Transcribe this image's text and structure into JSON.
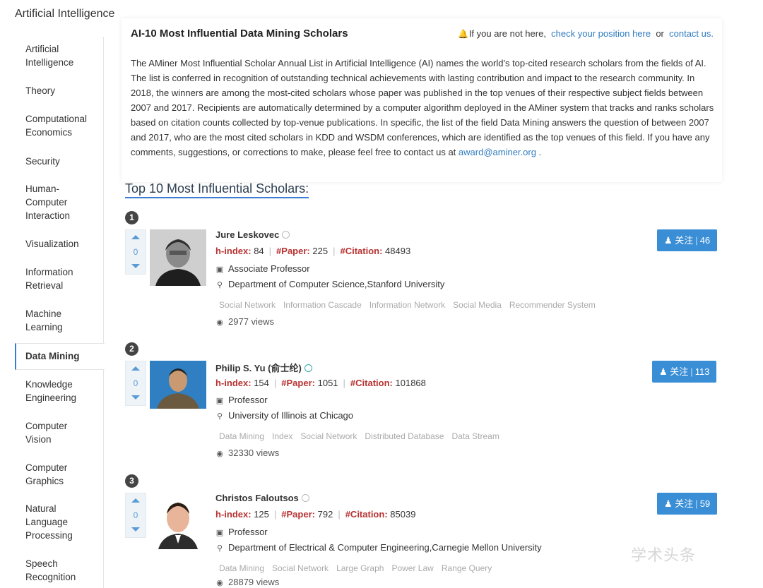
{
  "section_title": "Artificial Intelligence",
  "sidebar": {
    "items": [
      {
        "label": "Artificial Intelligence",
        "lines": [
          "Artificial",
          "Intelligence"
        ]
      },
      {
        "label": "Theory",
        "lines": [
          "Theory"
        ]
      },
      {
        "label": "Computational Economics",
        "lines": [
          "Computational",
          "Economics"
        ]
      },
      {
        "label": "Security",
        "lines": [
          "Security"
        ]
      },
      {
        "label": "Human-Computer Interaction",
        "lines": [
          "Human-",
          "Computer",
          "Interaction"
        ]
      },
      {
        "label": "Visualization",
        "lines": [
          "Visualization"
        ]
      },
      {
        "label": "Information Retrieval",
        "lines": [
          "Information",
          "Retrieval"
        ]
      },
      {
        "label": "Machine Learning",
        "lines": [
          "Machine",
          "Learning"
        ]
      },
      {
        "label": "Data Mining",
        "lines": [
          "Data Mining"
        ],
        "active": true
      },
      {
        "label": "Knowledge Engineering",
        "lines": [
          "Knowledge",
          "Engineering"
        ]
      },
      {
        "label": "Computer Vision",
        "lines": [
          "Computer",
          "Vision"
        ]
      },
      {
        "label": "Computer Graphics",
        "lines": [
          "Computer",
          "Graphics"
        ]
      },
      {
        "label": "Natural Language Processing",
        "lines": [
          "Natural",
          "Language",
          "Processing"
        ]
      },
      {
        "label": "Speech Recognition",
        "lines": [
          "Speech",
          "Recognition"
        ]
      }
    ]
  },
  "intro": {
    "title": "AI-10 Most Influential Data Mining Scholars",
    "notice_text": "If you are not here,",
    "check_link": "check your position here",
    "or_text": "or",
    "contact_link": "contact us.",
    "body": "The AMiner Most Influential Scholar Annual List in Artificial Intelligence (AI) names the world's top-cited research scholars from the fields of AI. The list is conferred in recognition of outstanding technical achievements with lasting contribution and impact to the research community. In 2018, the winners are among the most-cited scholars whose paper was published in the top venues of their respective subject fields between 2007 and 2017. Recipients are automatically determined by a computer algorithm deployed in the AMiner system that tracks and ranks scholars based on citation counts collected by top-venue publications. In specific, the list of the field Data Mining answers the question of between 2007 and 2017, who are the most cited scholars in KDD and WSDM conferences, which are identified as the top venues of this field. If you have any comments, suggestions, or corrections to make, please feel free to contact us at",
    "email": "award@aminer.org",
    "end": "."
  },
  "list_heading": "Top 10 Most Influential Scholars:",
  "labels": {
    "hindex": "h-index:",
    "paper": "#Paper:",
    "citation": "#Citation:",
    "views_suffix": "views",
    "follow": "关注"
  },
  "scholars": [
    {
      "rank": "1",
      "votes": "0",
      "name": "Jure Leskovec",
      "hindex": "84",
      "papers": "225",
      "citations": "48493",
      "position": "Associate Professor",
      "affiliation": "Department of Computer Science,Stanford University",
      "tags": [
        "Social Network",
        "Information Cascade",
        "Information Network",
        "Social Media",
        "Recommender System"
      ],
      "views": "2977",
      "followers": "46"
    },
    {
      "rank": "2",
      "votes": "0",
      "name": "Philip S. Yu (俞士纶)",
      "hindex": "154",
      "papers": "1051",
      "citations": "101868",
      "position": "Professor",
      "affiliation": "University of Illinois at Chicago",
      "tags": [
        "Data Mining",
        "Index",
        "Social Network",
        "Distributed Database",
        "Data Stream"
      ],
      "views": "32330",
      "followers": "113"
    },
    {
      "rank": "3",
      "votes": "0",
      "name": "Christos Faloutsos",
      "hindex": "125",
      "papers": "792",
      "citations": "85039",
      "position": "Professor",
      "affiliation": "Department of Electrical & Computer Engineering,Carnegie Mellon University",
      "tags": [
        "Data Mining",
        "Social Network",
        "Large Graph",
        "Power Law",
        "Range Query"
      ],
      "views": "28879",
      "followers": "59"
    }
  ],
  "watermark": "学术头条",
  "icons": {
    "bell": "bell-icon",
    "briefcase": "briefcase-icon",
    "location": "map-pin-icon",
    "eye": "eye-icon",
    "user_add": "user-plus-icon"
  },
  "colors": {
    "accent": "#3a8ed6",
    "metric_label": "#b83232",
    "link": "#2f7bbf"
  }
}
